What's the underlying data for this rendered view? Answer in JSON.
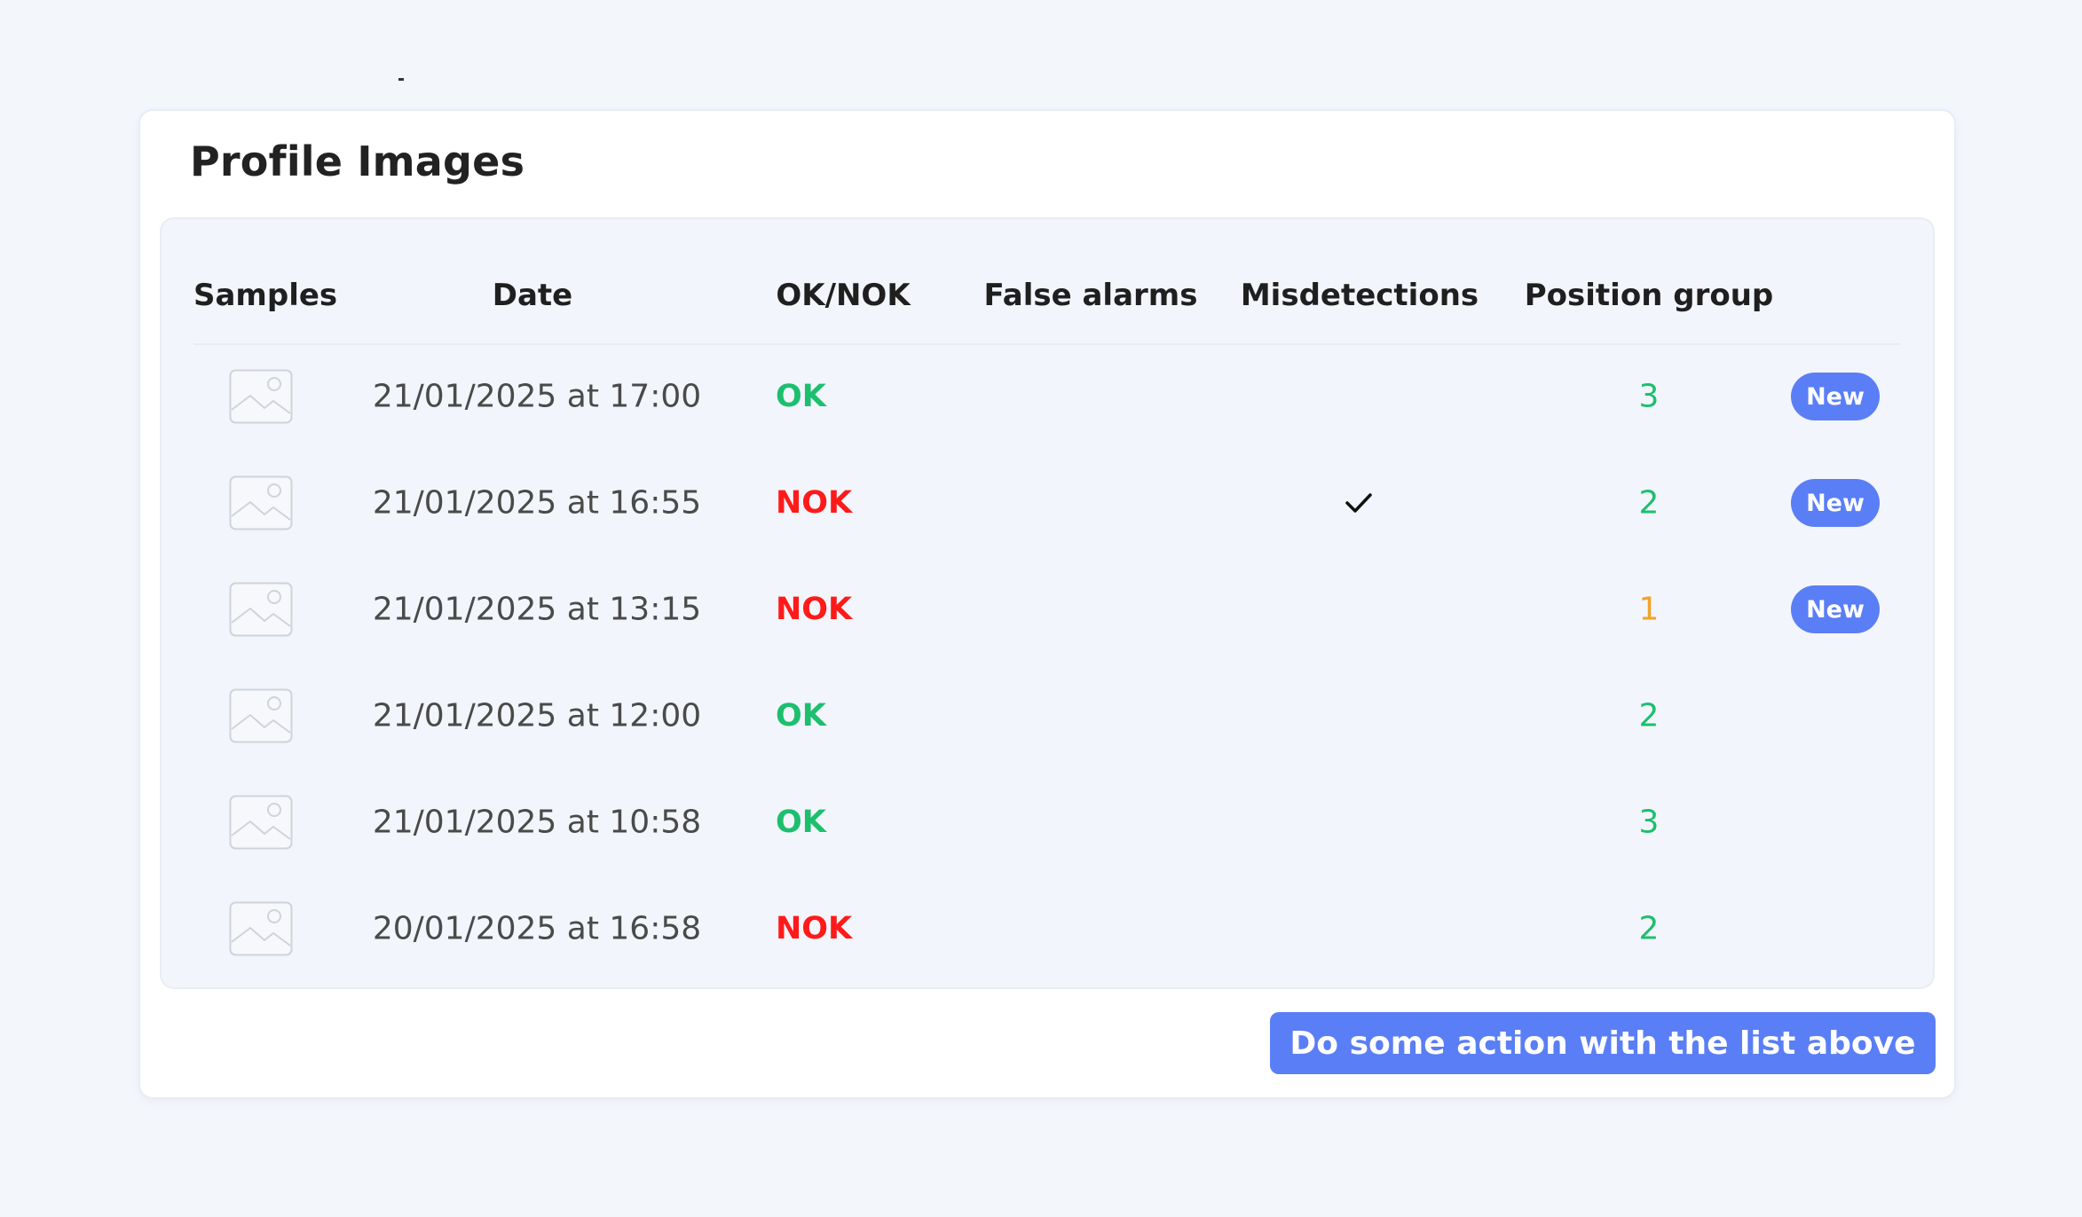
{
  "card": {
    "title": "Profile Images"
  },
  "table": {
    "columns": {
      "samples": "Samples",
      "date": "Date",
      "status": "OK/NOK",
      "false_alarms": "False alarms",
      "misdetections": "Misdetections",
      "position_group": "Position group"
    },
    "rows": [
      {
        "sample_icon": "image-placeholder-icon",
        "date": "21/01/2025 at 17:00",
        "status": "OK",
        "false_alarm": false,
        "misdetection": false,
        "position_group": "3",
        "badge": "New"
      },
      {
        "sample_icon": "image-placeholder-icon",
        "date": "21/01/2025 at 16:55",
        "status": "NOK",
        "false_alarm": false,
        "misdetection": true,
        "position_group": "2",
        "badge": "New"
      },
      {
        "sample_icon": "image-placeholder-icon",
        "date": "21/01/2025 at 13:15",
        "status": "NOK",
        "false_alarm": false,
        "misdetection": false,
        "position_group": "1",
        "badge": "New"
      },
      {
        "sample_icon": "image-placeholder-icon",
        "date": "21/01/2025 at 12:00",
        "status": "OK",
        "false_alarm": false,
        "misdetection": false,
        "position_group": "2",
        "badge": ""
      },
      {
        "sample_icon": "image-placeholder-icon",
        "date": "21/01/2025 at 10:58",
        "status": "OK",
        "false_alarm": false,
        "misdetection": false,
        "position_group": "3",
        "badge": ""
      },
      {
        "sample_icon": "image-placeholder-icon",
        "date": "20/01/2025 at 16:58",
        "status": "NOK",
        "false_alarm": false,
        "misdetection": false,
        "position_group": "2",
        "badge": ""
      }
    ]
  },
  "action_button": {
    "label": "Do some action with the list above"
  },
  "colors": {
    "page_background": "#f3f6fb",
    "accent": "#5a7ef5",
    "ok": "#1dbf6e",
    "nok": "#ff1a1a",
    "group_high": "#1dbf6e",
    "group_low": "#f2a22a"
  }
}
